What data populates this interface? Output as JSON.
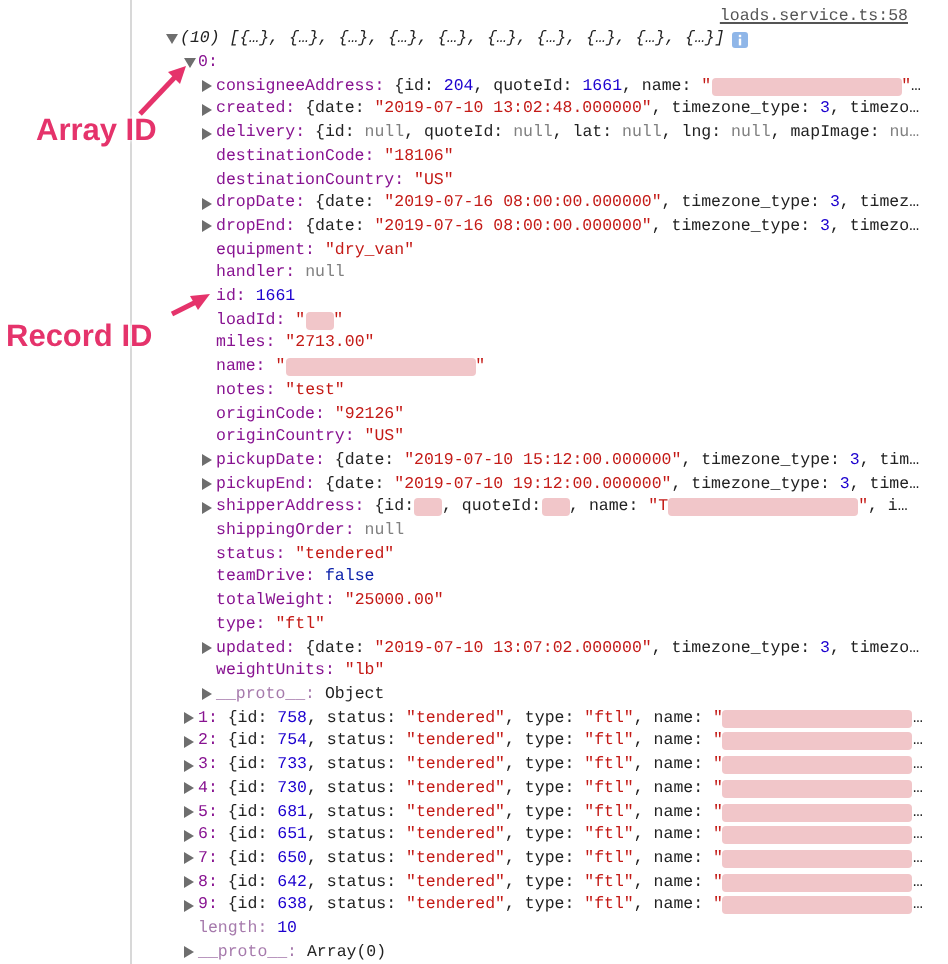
{
  "source_link": "loads.service.ts:58",
  "log": {
    "kind": "object",
    "expanded": true,
    "summary": "(10) [{…}, {…}, {…}, {…}, {…}, {…}, {…}, {…}, {…}, {…}]",
    "children": [
      {
        "label": "0:",
        "kind": "object",
        "expanded": true,
        "children": [
          {
            "label": "consigneeAddress:",
            "kind": "object",
            "expanded": false,
            "value": [
              {
                "kind": "plain",
                "text": "{id: "
              },
              {
                "kind": "number",
                "text": "204"
              },
              {
                "kind": "plain",
                "text": ", quoteId: "
              },
              {
                "kind": "number",
                "text": "1661"
              },
              {
                "kind": "plain",
                "text": ", name: "
              },
              {
                "kind": "string",
                "text": "\""
              },
              {
                "kind": "longblur"
              },
              {
                "kind": "string",
                "text": "\""
              },
              {
                "kind": "plain",
                "text": "…"
              }
            ]
          },
          {
            "label": "created:",
            "kind": "object",
            "expanded": false,
            "value": [
              {
                "kind": "plain",
                "text": "{date: "
              },
              {
                "kind": "string",
                "text": "\"2019-07-10 13:02:48.000000\""
              },
              {
                "kind": "plain",
                "text": ", timezone_type: "
              },
              {
                "kind": "number",
                "text": "3"
              },
              {
                "kind": "plain",
                "text": ", timezo…"
              }
            ]
          },
          {
            "label": "delivery:",
            "kind": "object",
            "expanded": false,
            "value": [
              {
                "kind": "plain",
                "text": "{id: "
              },
              {
                "kind": "null",
                "text": "null"
              },
              {
                "kind": "plain",
                "text": ", quoteId: "
              },
              {
                "kind": "null",
                "text": "null"
              },
              {
                "kind": "plain",
                "text": ", lat: "
              },
              {
                "kind": "null",
                "text": "null"
              },
              {
                "kind": "plain",
                "text": ", lng: "
              },
              {
                "kind": "null",
                "text": "null"
              },
              {
                "kind": "plain",
                "text": ", mapImage: "
              },
              {
                "kind": "null",
                "text": "nu…"
              }
            ]
          },
          {
            "label": "destinationCode:",
            "kind": "leaf",
            "value": [
              {
                "kind": "string",
                "text": "\"18106\""
              }
            ]
          },
          {
            "label": "destinationCountry:",
            "kind": "leaf",
            "value": [
              {
                "kind": "string",
                "text": "\"US\""
              }
            ]
          },
          {
            "label": "dropDate:",
            "kind": "object",
            "expanded": false,
            "value": [
              {
                "kind": "plain",
                "text": "{date: "
              },
              {
                "kind": "string",
                "text": "\"2019-07-16 08:00:00.000000\""
              },
              {
                "kind": "plain",
                "text": ", timezone_type: "
              },
              {
                "kind": "number",
                "text": "3"
              },
              {
                "kind": "plain",
                "text": ", timez…"
              }
            ]
          },
          {
            "label": "dropEnd:",
            "kind": "object",
            "expanded": false,
            "value": [
              {
                "kind": "plain",
                "text": "{date: "
              },
              {
                "kind": "string",
                "text": "\"2019-07-16 08:00:00.000000\""
              },
              {
                "kind": "plain",
                "text": ", timezone_type: "
              },
              {
                "kind": "number",
                "text": "3"
              },
              {
                "kind": "plain",
                "text": ", timezo…"
              }
            ]
          },
          {
            "label": "equipment:",
            "kind": "leaf",
            "value": [
              {
                "kind": "string",
                "text": "\"dry_van\""
              }
            ]
          },
          {
            "label": "handler:",
            "kind": "leaf",
            "value": [
              {
                "kind": "null",
                "text": "null"
              }
            ]
          },
          {
            "label": "id:",
            "kind": "leaf",
            "value": [
              {
                "kind": "number",
                "text": "1661"
              }
            ]
          },
          {
            "label": "loadId:",
            "kind": "leaf",
            "value": [
              {
                "kind": "string",
                "text": "\""
              },
              {
                "kind": "blur"
              },
              {
                "kind": "string",
                "text": "\""
              }
            ]
          },
          {
            "label": "miles:",
            "kind": "leaf",
            "value": [
              {
                "kind": "string",
                "text": "\"2713.00\""
              }
            ]
          },
          {
            "label": "name:",
            "kind": "leaf",
            "value": [
              {
                "kind": "string",
                "text": "\""
              },
              {
                "kind": "longblur"
              },
              {
                "kind": "string",
                "text": "\""
              }
            ]
          },
          {
            "label": "notes:",
            "kind": "leaf",
            "value": [
              {
                "kind": "string",
                "text": "\"test\""
              }
            ]
          },
          {
            "label": "originCode:",
            "kind": "leaf",
            "value": [
              {
                "kind": "string",
                "text": "\"92126\""
              }
            ]
          },
          {
            "label": "originCountry:",
            "kind": "leaf",
            "value": [
              {
                "kind": "string",
                "text": "\"US\""
              }
            ]
          },
          {
            "label": "pickupDate:",
            "kind": "object",
            "expanded": false,
            "value": [
              {
                "kind": "plain",
                "text": "{date: "
              },
              {
                "kind": "string",
                "text": "\"2019-07-10 15:12:00.000000\""
              },
              {
                "kind": "plain",
                "text": ", timezone_type: "
              },
              {
                "kind": "number",
                "text": "3"
              },
              {
                "kind": "plain",
                "text": ", tim…"
              }
            ]
          },
          {
            "label": "pickupEnd:",
            "kind": "object",
            "expanded": false,
            "value": [
              {
                "kind": "plain",
                "text": "{date: "
              },
              {
                "kind": "string",
                "text": "\"2019-07-10 19:12:00.000000\""
              },
              {
                "kind": "plain",
                "text": ", timezone_type: "
              },
              {
                "kind": "number",
                "text": "3"
              },
              {
                "kind": "plain",
                "text": ", time…"
              }
            ]
          },
          {
            "label": "shipperAddress:",
            "kind": "object",
            "expanded": false,
            "value": [
              {
                "kind": "plain",
                "text": "{id: "
              },
              {
                "kind": "blur"
              },
              {
                "kind": "plain",
                "text": ", quoteId: "
              },
              {
                "kind": "blur"
              },
              {
                "kind": "plain",
                "text": ", name: "
              },
              {
                "kind": "string",
                "text": "\"T"
              },
              {
                "kind": "longblur"
              },
              {
                "kind": "string",
                "text": "\""
              },
              {
                "kind": "plain",
                "text": ", i…"
              }
            ]
          },
          {
            "label": "shippingOrder:",
            "kind": "leaf",
            "value": [
              {
                "kind": "null",
                "text": "null"
              }
            ]
          },
          {
            "label": "status:",
            "kind": "leaf",
            "value": [
              {
                "kind": "string",
                "text": "\"tendered\""
              }
            ]
          },
          {
            "label": "teamDrive:",
            "kind": "leaf",
            "value": [
              {
                "kind": "boolean",
                "text": "false"
              }
            ]
          },
          {
            "label": "totalWeight:",
            "kind": "leaf",
            "value": [
              {
                "kind": "string",
                "text": "\"25000.00\""
              }
            ]
          },
          {
            "label": "type:",
            "kind": "leaf",
            "value": [
              {
                "kind": "string",
                "text": "\"ftl\""
              }
            ]
          },
          {
            "label": "updated:",
            "kind": "object",
            "expanded": false,
            "value": [
              {
                "kind": "plain",
                "text": "{date: "
              },
              {
                "kind": "string",
                "text": "\"2019-07-10 13:07:02.000000\""
              },
              {
                "kind": "plain",
                "text": ", timezone_type: "
              },
              {
                "kind": "number",
                "text": "3"
              },
              {
                "kind": "plain",
                "text": ", timezo…"
              }
            ]
          },
          {
            "label": "weightUnits:",
            "kind": "leaf",
            "value": [
              {
                "kind": "string",
                "text": "\"lb\""
              }
            ]
          },
          {
            "label": "__proto__:",
            "kind": "object",
            "expanded": false,
            "dim": true,
            "value": [
              {
                "kind": "plain",
                "text": "Object"
              }
            ]
          }
        ]
      },
      {
        "label": "1:",
        "kind": "object",
        "expanded": false,
        "value": [
          {
            "kind": "plain",
            "text": "{id: "
          },
          {
            "kind": "number",
            "text": "758"
          },
          {
            "kind": "plain",
            "text": ", status: "
          },
          {
            "kind": "string",
            "text": "\"tendered\""
          },
          {
            "kind": "plain",
            "text": ", type: "
          },
          {
            "kind": "string",
            "text": "\"ftl\""
          },
          {
            "kind": "plain",
            "text": ", name: "
          },
          {
            "kind": "string",
            "text": "\""
          },
          {
            "kind": "longblur"
          },
          {
            "kind": "plain",
            "text": "…"
          }
        ]
      },
      {
        "label": "2:",
        "kind": "object",
        "expanded": false,
        "value": [
          {
            "kind": "plain",
            "text": "{id: "
          },
          {
            "kind": "number",
            "text": "754"
          },
          {
            "kind": "plain",
            "text": ", status: "
          },
          {
            "kind": "string",
            "text": "\"tendered\""
          },
          {
            "kind": "plain",
            "text": ", type: "
          },
          {
            "kind": "string",
            "text": "\"ftl\""
          },
          {
            "kind": "plain",
            "text": ", name: "
          },
          {
            "kind": "string",
            "text": "\""
          },
          {
            "kind": "longblur"
          },
          {
            "kind": "plain",
            "text": "…"
          }
        ]
      },
      {
        "label": "3:",
        "kind": "object",
        "expanded": false,
        "value": [
          {
            "kind": "plain",
            "text": "{id: "
          },
          {
            "kind": "number",
            "text": "733"
          },
          {
            "kind": "plain",
            "text": ", status: "
          },
          {
            "kind": "string",
            "text": "\"tendered\""
          },
          {
            "kind": "plain",
            "text": ", type: "
          },
          {
            "kind": "string",
            "text": "\"ftl\""
          },
          {
            "kind": "plain",
            "text": ", name: "
          },
          {
            "kind": "string",
            "text": "\""
          },
          {
            "kind": "longblur"
          },
          {
            "kind": "plain",
            "text": "…"
          }
        ]
      },
      {
        "label": "4:",
        "kind": "object",
        "expanded": false,
        "value": [
          {
            "kind": "plain",
            "text": "{id: "
          },
          {
            "kind": "number",
            "text": "730"
          },
          {
            "kind": "plain",
            "text": ", status: "
          },
          {
            "kind": "string",
            "text": "\"tendered\""
          },
          {
            "kind": "plain",
            "text": ", type: "
          },
          {
            "kind": "string",
            "text": "\"ftl\""
          },
          {
            "kind": "plain",
            "text": ", name: "
          },
          {
            "kind": "string",
            "text": "\""
          },
          {
            "kind": "longblur"
          },
          {
            "kind": "plain",
            "text": "…"
          }
        ]
      },
      {
        "label": "5:",
        "kind": "object",
        "expanded": false,
        "value": [
          {
            "kind": "plain",
            "text": "{id: "
          },
          {
            "kind": "number",
            "text": "681"
          },
          {
            "kind": "plain",
            "text": ", status: "
          },
          {
            "kind": "string",
            "text": "\"tendered\""
          },
          {
            "kind": "plain",
            "text": ", type: "
          },
          {
            "kind": "string",
            "text": "\"ftl\""
          },
          {
            "kind": "plain",
            "text": ", name: "
          },
          {
            "kind": "string",
            "text": "\""
          },
          {
            "kind": "longblur"
          },
          {
            "kind": "plain",
            "text": "…"
          }
        ]
      },
      {
        "label": "6:",
        "kind": "object",
        "expanded": false,
        "value": [
          {
            "kind": "plain",
            "text": "{id: "
          },
          {
            "kind": "number",
            "text": "651"
          },
          {
            "kind": "plain",
            "text": ", status: "
          },
          {
            "kind": "string",
            "text": "\"tendered\""
          },
          {
            "kind": "plain",
            "text": ", type: "
          },
          {
            "kind": "string",
            "text": "\"ftl\""
          },
          {
            "kind": "plain",
            "text": ", name: "
          },
          {
            "kind": "string",
            "text": "\""
          },
          {
            "kind": "longblur"
          },
          {
            "kind": "plain",
            "text": "…"
          }
        ]
      },
      {
        "label": "7:",
        "kind": "object",
        "expanded": false,
        "value": [
          {
            "kind": "plain",
            "text": "{id: "
          },
          {
            "kind": "number",
            "text": "650"
          },
          {
            "kind": "plain",
            "text": ", status: "
          },
          {
            "kind": "string",
            "text": "\"tendered\""
          },
          {
            "kind": "plain",
            "text": ", type: "
          },
          {
            "kind": "string",
            "text": "\"ftl\""
          },
          {
            "kind": "plain",
            "text": ", name: "
          },
          {
            "kind": "string",
            "text": "\""
          },
          {
            "kind": "longblur"
          },
          {
            "kind": "plain",
            "text": "…"
          }
        ]
      },
      {
        "label": "8:",
        "kind": "object",
        "expanded": false,
        "value": [
          {
            "kind": "plain",
            "text": "{id: "
          },
          {
            "kind": "number",
            "text": "642"
          },
          {
            "kind": "plain",
            "text": ", status: "
          },
          {
            "kind": "string",
            "text": "\"tendered\""
          },
          {
            "kind": "plain",
            "text": ", type: "
          },
          {
            "kind": "string",
            "text": "\"ftl\""
          },
          {
            "kind": "plain",
            "text": ", name: "
          },
          {
            "kind": "string",
            "text": "\""
          },
          {
            "kind": "longblur"
          },
          {
            "kind": "plain",
            "text": "…"
          }
        ]
      },
      {
        "label": "9:",
        "kind": "object",
        "expanded": false,
        "value": [
          {
            "kind": "plain",
            "text": "{id: "
          },
          {
            "kind": "number",
            "text": "638"
          },
          {
            "kind": "plain",
            "text": ", status: "
          },
          {
            "kind": "string",
            "text": "\"tendered\""
          },
          {
            "kind": "plain",
            "text": ", type: "
          },
          {
            "kind": "string",
            "text": "\"ftl\""
          },
          {
            "kind": "plain",
            "text": ", name: "
          },
          {
            "kind": "string",
            "text": "\""
          },
          {
            "kind": "longblur"
          },
          {
            "kind": "plain",
            "text": "…"
          }
        ]
      },
      {
        "label": "length:",
        "kind": "leaf",
        "dim": true,
        "value": [
          {
            "kind": "number",
            "text": "10"
          }
        ]
      },
      {
        "label": "__proto__:",
        "kind": "object",
        "expanded": false,
        "dim": true,
        "value": [
          {
            "kind": "plain",
            "text": "Array(0)"
          }
        ]
      }
    ]
  },
  "annotations": [
    {
      "text": "Array ID"
    },
    {
      "text": "Record ID"
    }
  ]
}
